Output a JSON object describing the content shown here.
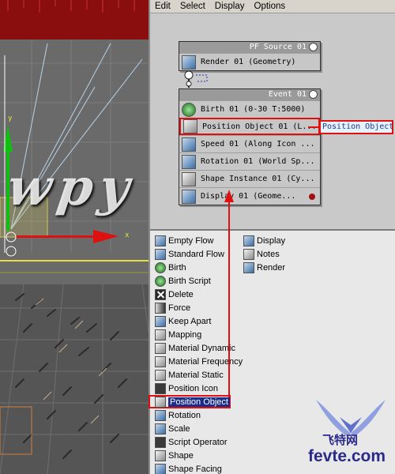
{
  "menu": [
    "Edit",
    "Select",
    "Display",
    "Options"
  ],
  "viewport": {
    "axis_y": "y",
    "axis_x": "x"
  },
  "pf_source": {
    "title": "PF Source 01",
    "operators": [
      {
        "label": "Render 01 (Geometry)",
        "icon": "render-icon"
      }
    ]
  },
  "event": {
    "title": "Event 01",
    "operators": [
      {
        "label": "Birth 01 (0-30 T:5000)",
        "icon": "birth-icon"
      },
      {
        "label": "Position Object 01 (L...",
        "icon": "position-object-icon"
      },
      {
        "label": "Speed 01 (Along Icon ...",
        "icon": "speed-icon"
      },
      {
        "label": "Rotation 01 (World Sp...",
        "icon": "rotation-icon"
      },
      {
        "label": "Shape Instance 01 (Cy...",
        "icon": "shape-instance-icon"
      },
      {
        "label": "Display 01 (Geome...",
        "icon": "display-icon"
      }
    ]
  },
  "callout": "Position Object",
  "depot": {
    "left": [
      {
        "label": "Empty Flow",
        "icon": "empty-flow-icon"
      },
      {
        "label": "Standard Flow",
        "icon": "standard-flow-icon"
      },
      {
        "label": "Birth",
        "icon": "birth-icon"
      },
      {
        "label": "Birth Script",
        "icon": "birth-script-icon"
      },
      {
        "label": "Delete",
        "icon": "delete-icon"
      },
      {
        "label": "Force",
        "icon": "force-icon"
      },
      {
        "label": "Keep Apart",
        "icon": "keep-apart-icon"
      },
      {
        "label": "Mapping",
        "icon": "mapping-icon"
      },
      {
        "label": "Material Dynamic",
        "icon": "material-dynamic-icon"
      },
      {
        "label": "Material Frequency",
        "icon": "material-frequency-icon"
      },
      {
        "label": "Material Static",
        "icon": "material-static-icon"
      },
      {
        "label": "Position Icon",
        "icon": "position-icon-icon"
      },
      {
        "label": "Position Object",
        "icon": "position-object-icon"
      },
      {
        "label": "Rotation",
        "icon": "rotation-icon"
      },
      {
        "label": "Scale",
        "icon": "scale-icon"
      },
      {
        "label": "Script Operator",
        "icon": "script-operator-icon"
      },
      {
        "label": "Shape",
        "icon": "shape-icon"
      },
      {
        "label": "Shape Facing",
        "icon": "shape-facing-icon"
      }
    ],
    "right": [
      {
        "label": "Display",
        "icon": "display-icon"
      },
      {
        "label": "Notes",
        "icon": "notes-icon"
      },
      {
        "label": "Render",
        "icon": "render-icon"
      }
    ],
    "selected": "Position Object"
  },
  "watermark": {
    "text": "wpy",
    "logo_cn": "飞特网",
    "logo_url": "fevte.com"
  },
  "colors": {
    "highlight": "#e01010",
    "selection": "#1a2d8a",
    "axis_green": "#10c010",
    "axis_red": "#e01010"
  }
}
